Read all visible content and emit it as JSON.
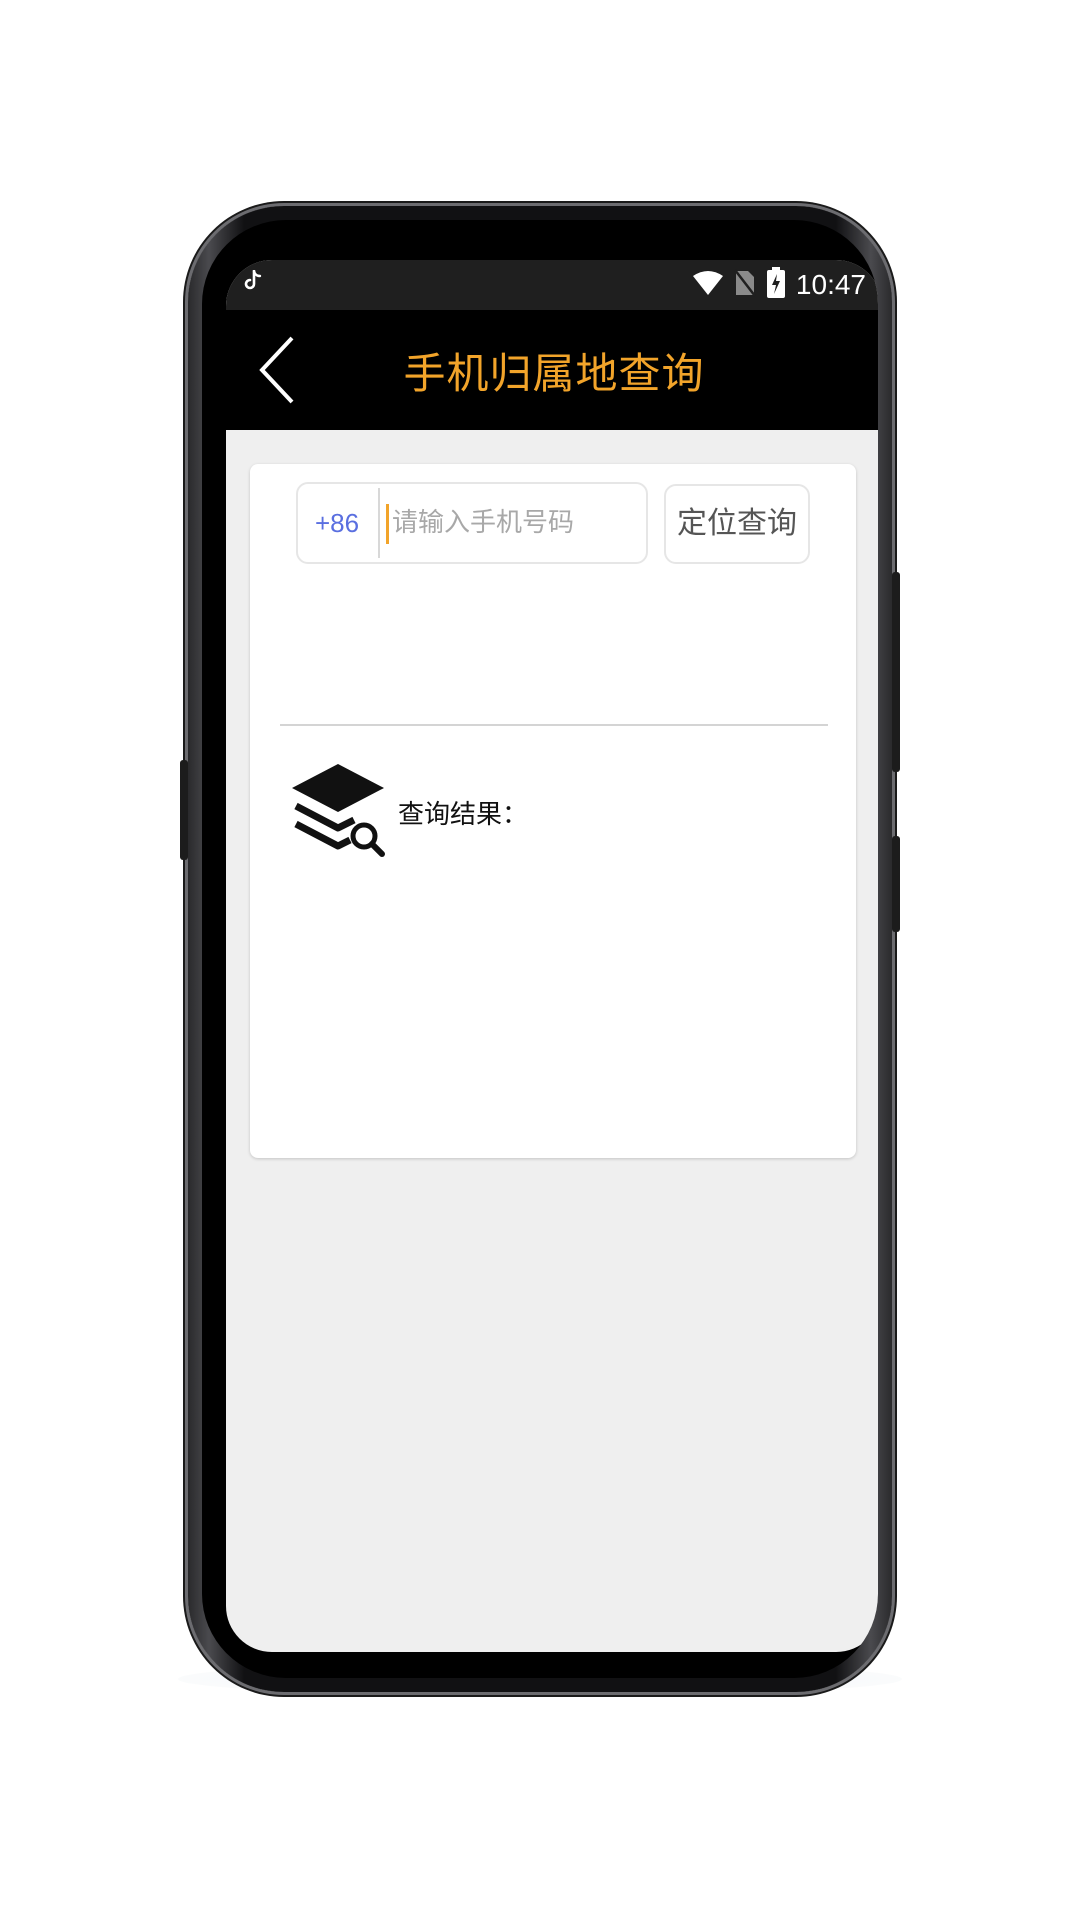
{
  "status_bar": {
    "notification_icon": "tiktok-icon",
    "time": "10:47",
    "icons": [
      "wifi-icon",
      "no-sim-icon",
      "battery-charging-icon"
    ]
  },
  "header": {
    "back_icon": "chevron-left-icon",
    "title": "手机归属地查询",
    "title_color": "#f2a42a",
    "background": "#000000"
  },
  "query": {
    "country_code": "+86",
    "country_code_color": "#5a6fe0",
    "phone_input_value": "",
    "phone_input_placeholder": "请输入手机号码",
    "submit_label": "定位查询"
  },
  "result": {
    "icon": "layers-search-icon",
    "label": "查询结果："
  }
}
